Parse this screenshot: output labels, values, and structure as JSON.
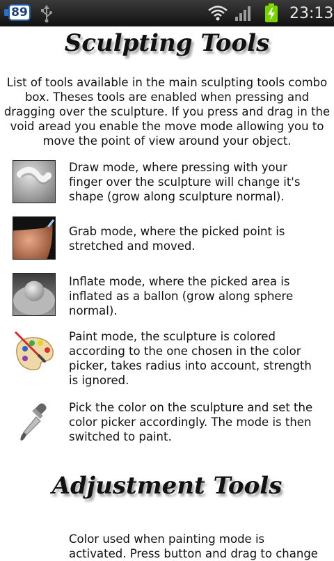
{
  "status_bar": {
    "notification_count": "89",
    "time": "23:13",
    "icons": [
      "usb-icon",
      "wifi-icon",
      "signal-icon",
      "battery-charging-icon"
    ]
  },
  "sculpting": {
    "title": "Sculpting Tools",
    "intro": "List of tools available in the main sculpting tools combo box. Theses tools are enabled when pressing and dragging over the sculpture. If you press and drag in the void aread you enable the move mode allowing you to move the point of view around your object.",
    "tools": [
      {
        "icon": "draw-mode-icon",
        "text": "Draw mode, where pressing with your finger over the sculpture will change it's shape (grow along sculpture normal)."
      },
      {
        "icon": "grab-mode-icon",
        "text": "Grab mode, where the picked point is stretched and moved."
      },
      {
        "icon": "inflate-mode-icon",
        "text": "Inflate mode, where the picked area is inflated as a ballon (grow along sphere normal)."
      },
      {
        "icon": "paint-palette-icon",
        "text": "Paint mode, the sculpture is colored according to the one chosen in the color picker, takes radius into account, strength is ignored."
      },
      {
        "icon": "color-picker-dropper-icon",
        "text": "Pick the color on the sculpture and set the color picker accordingly. The mode is then switched to paint."
      }
    ]
  },
  "adjustment": {
    "title": "Adjustment Tools",
    "items": [
      {
        "text": "Color used when painting mode is activated. Press button and drag to change"
      }
    ]
  }
}
